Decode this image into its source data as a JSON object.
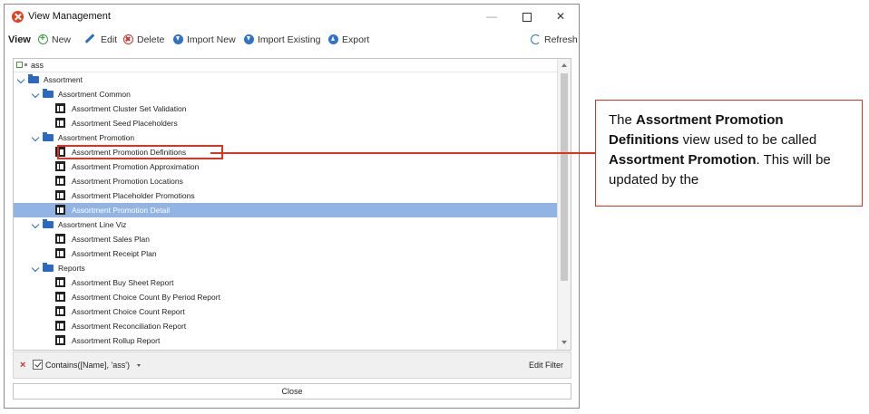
{
  "window": {
    "title": "View Management",
    "controls": {
      "minimize": "—",
      "close": "✕"
    }
  },
  "toolbar": {
    "label": "View",
    "new": "New",
    "edit": "Edit",
    "delete": "Delete",
    "import_new": "Import New",
    "import_existing": "Import Existing",
    "export": "Export",
    "refresh": "Refresh"
  },
  "search": {
    "value": "ass"
  },
  "tree": [
    {
      "type": "folder",
      "level": 0,
      "label": "Assortment"
    },
    {
      "type": "folder",
      "level": 1,
      "label": "Assortment Common"
    },
    {
      "type": "view",
      "level": 2,
      "label": "Assortment Cluster Set Validation"
    },
    {
      "type": "view",
      "level": 2,
      "label": "Assortment Seed Placeholders"
    },
    {
      "type": "folder",
      "level": 1,
      "label": "Assortment Promotion"
    },
    {
      "type": "view",
      "level": 2,
      "label": "Assortment Promotion Definitions",
      "highlighted": true
    },
    {
      "type": "view",
      "level": 2,
      "label": "Assortment Promotion Approximation"
    },
    {
      "type": "view",
      "level": 2,
      "label": "Assortment Promotion Locations"
    },
    {
      "type": "view",
      "level": 2,
      "label": "Assortment Placeholder Promotions"
    },
    {
      "type": "view",
      "level": 2,
      "label": "Assortment Promotion Detail",
      "selected": true
    },
    {
      "type": "folder",
      "level": 1,
      "label": "Assortment Line Viz"
    },
    {
      "type": "view",
      "level": 2,
      "label": "Assortment Sales Plan"
    },
    {
      "type": "view",
      "level": 2,
      "label": "Assortment Receipt Plan"
    },
    {
      "type": "folder",
      "level": 1,
      "label": "Reports"
    },
    {
      "type": "view",
      "level": 2,
      "label": "Assortment Buy Sheet Report"
    },
    {
      "type": "view",
      "level": 2,
      "label": "Assortment Choice Count By Period Report"
    },
    {
      "type": "view",
      "level": 2,
      "label": "Assortment Choice Count Report"
    },
    {
      "type": "view",
      "level": 2,
      "label": "Assortment Reconciliation Report"
    },
    {
      "type": "view",
      "level": 2,
      "label": "Assortment Rollup Report"
    }
  ],
  "filter": {
    "expression": "Contains([Name], 'ass')",
    "edit_label": "Edit Filter"
  },
  "close_label": "Close",
  "callout": {
    "part1": "The ",
    "bold1": "Assortment Promotion Definitions",
    "part2": " view used to be called ",
    "bold2": "Assortment Promotion",
    "part3": ". This will be updated by the"
  },
  "colors": {
    "selection": "#92b4e4",
    "callout_border": "#e0321e",
    "folder": "#2a6bbf"
  }
}
